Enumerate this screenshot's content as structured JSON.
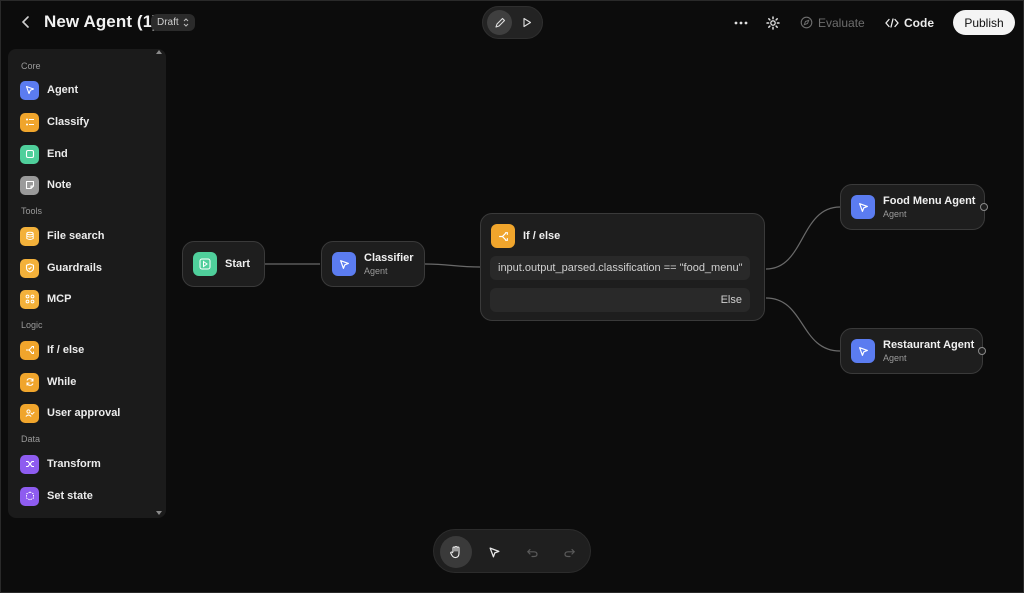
{
  "header": {
    "title": "New Agent (1)",
    "status_badge": "Draft",
    "evaluate_label": "Evaluate",
    "code_label": "Code",
    "publish_label": "Publish"
  },
  "sidebar": {
    "sections": [
      {
        "label": "Core"
      },
      {
        "label": "Tools"
      },
      {
        "label": "Logic"
      },
      {
        "label": "Data"
      }
    ],
    "items": [
      {
        "label": "Agent",
        "icon": "agent-icon",
        "color": "#5b7cf0"
      },
      {
        "label": "Classify",
        "icon": "classify-icon",
        "color": "#f0a52c"
      },
      {
        "label": "End",
        "icon": "end-icon",
        "color": "#4fcf9b"
      },
      {
        "label": "Note",
        "icon": "note-icon",
        "color": "#9a9a9a"
      },
      {
        "label": "File search",
        "icon": "file-search-icon",
        "color": "#f3b13a"
      },
      {
        "label": "Guardrails",
        "icon": "guardrails-icon",
        "color": "#f3b13a"
      },
      {
        "label": "MCP",
        "icon": "mcp-icon",
        "color": "#f3b13a"
      },
      {
        "label": "If / else",
        "icon": "if-else-icon",
        "color": "#f0a52c"
      },
      {
        "label": "While",
        "icon": "while-icon",
        "color": "#f0a52c"
      },
      {
        "label": "User approval",
        "icon": "user-approval-icon",
        "color": "#f0a52c"
      },
      {
        "label": "Transform",
        "icon": "transform-icon",
        "color": "#8e5cf0"
      },
      {
        "label": "Set state",
        "icon": "set-state-icon",
        "color": "#8e5cf0"
      }
    ]
  },
  "nodes": {
    "start": {
      "label": "Start",
      "color": "#4fcf9b"
    },
    "classifier": {
      "label": "Classifier",
      "sub": "Agent",
      "color": "#5b7cf0"
    },
    "if_else": {
      "label": "If / else",
      "color": "#f0a52c",
      "condition": "input.output_parsed.classification == \"food_menu\"",
      "else_label": "Else"
    },
    "food_menu_agent": {
      "label": "Food Menu Agent",
      "sub": "Agent",
      "color": "#5b7cf0"
    },
    "restaurant_agent": {
      "label": "Restaurant Agent",
      "sub": "Agent",
      "color": "#5b7cf0"
    }
  },
  "toolbar": {
    "tools": [
      "hand-icon",
      "pointer-icon",
      "undo-icon",
      "redo-icon"
    ]
  }
}
